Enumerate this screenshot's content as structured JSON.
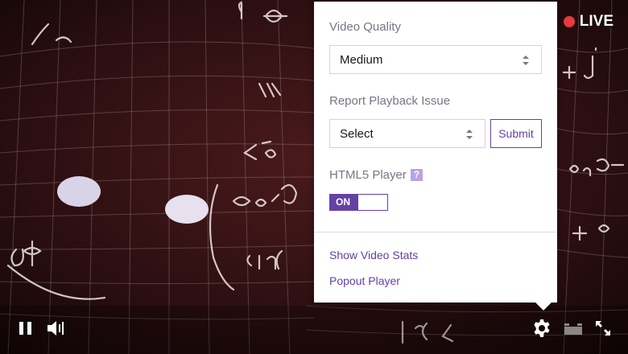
{
  "player": {
    "live_label": "LIVE",
    "colors": {
      "live": "#e83a3f",
      "accent": "#6441a4"
    },
    "icons": [
      "pause-icon",
      "volume-icon",
      "gear-icon",
      "theatre-mode-icon",
      "fullscreen-icon"
    ]
  },
  "settings": {
    "quality_label": "Video Quality",
    "quality_value": "Medium",
    "report_label": "Report Playback Issue",
    "report_value": "Select",
    "submit_label": "Submit",
    "html5_label": "HTML5 Player",
    "help_glyph": "?",
    "toggle_label": "ON",
    "toggle_on": true,
    "links": [
      "Show Video Stats",
      "Popout Player"
    ]
  }
}
